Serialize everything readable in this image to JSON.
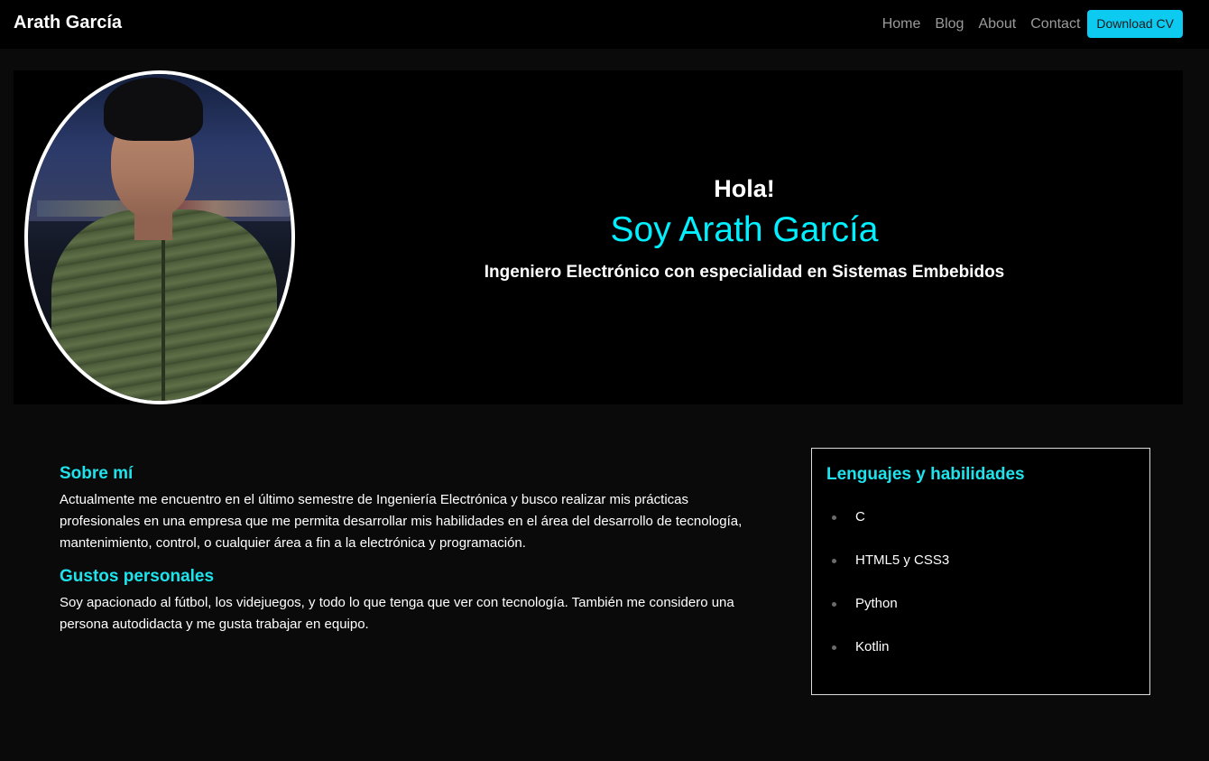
{
  "navbar": {
    "brand": "Arath García",
    "links": [
      "Home",
      "Blog",
      "About",
      "Contact"
    ],
    "cv_button": "Download CV"
  },
  "hero": {
    "greeting": "Hola!",
    "name": "Soy Arath García",
    "subtitle": "Ingeniero Electrónico con especialidad en Sistemas Embebidos"
  },
  "about": {
    "heading": "Sobre mí",
    "text": "Actualmente me encuentro en el último semestre de Ingeniería Electrónica y busco realizar mis prácticas profesionales en una empresa que me permita desarrollar mis habilidades en el área del desarrollo de tecnología, mantenimiento, control, o cualquier área a fin a la electrónica y programación.",
    "hobbies_heading": "Gustos personales",
    "hobbies_text": "Soy apacionado al fútbol, los videjuegos, y todo lo que tenga que ver con tecnología. También me considero una persona autodidacta y me gusta trabajar en equipo."
  },
  "skills": {
    "title": "Lenguajes y habilidades",
    "items": [
      "C",
      "HTML5 y CSS3",
      "Python",
      "Kotlin"
    ]
  },
  "colors": {
    "accent": "#00f0ff",
    "button": "#0dcaf0",
    "background": "#0a0a0a"
  }
}
